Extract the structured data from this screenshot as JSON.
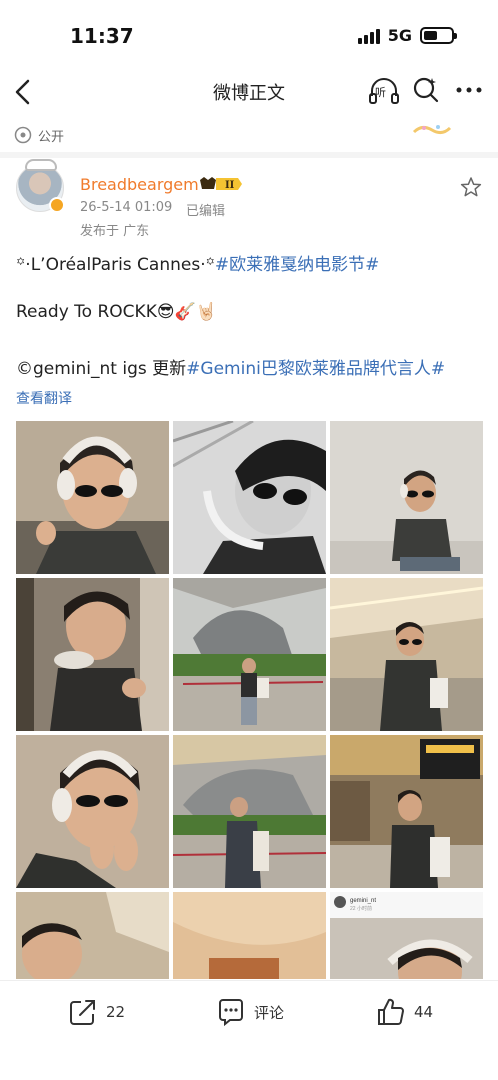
{
  "status_bar": {
    "time": "11:37",
    "network": "5G"
  },
  "nav": {
    "title": "微博正文",
    "listen_label": "听"
  },
  "visibility": {
    "label": "公开"
  },
  "post": {
    "author": "Breadbeargem",
    "vip_level": "II",
    "time": "26-5-14 01:09",
    "edited": "已编辑",
    "location": "发布于 广东",
    "line1_prefix": "꙳·L’OréalParis Cannes·꙳",
    "line1_hashtag": "#欧莱雅戛纳电影节#",
    "line2": "Ready To ROCKK😎🎸🤘🏻",
    "line3_prefix": "©gemini_nt igs 更新",
    "line3_hashtag": "#Gemini巴黎欧莱雅品牌代言人#",
    "translate": "查看翻译"
  },
  "gallery": {
    "photos": [
      "selfie-headphones-sunglasses",
      "bw-selfie-sunglasses",
      "seated-headphones-sunglasses",
      "selfie-in-car",
      "airport-sculpture-standing",
      "airport-walkway-standing",
      "selfie-hands-on-face",
      "airport-sculpture-walking",
      "airport-shops-walking",
      "closeup-reclining",
      "closeup-bag",
      "instagram-screenshot"
    ],
    "ig_handle": "gemini_nt",
    "ig_caption": "22 小时前"
  },
  "actions": {
    "share_count": "22",
    "comment_label": "评论",
    "like_count": "44"
  },
  "colors": {
    "username": "#f07b2c",
    "hashtag": "#3b6fb6",
    "meta": "#888888"
  }
}
